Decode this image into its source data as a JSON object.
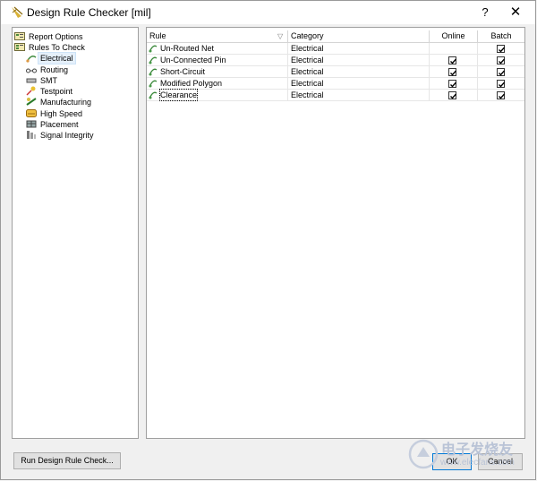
{
  "window": {
    "title": "Design Rule Checker [mil]",
    "help_glyph": "?",
    "close_glyph": "✕"
  },
  "tree": {
    "items": [
      {
        "label": "Report Options",
        "icon": "report-options-icon"
      },
      {
        "label": "Rules To Check",
        "icon": "rules-to-check-icon"
      },
      {
        "label": "Electrical",
        "icon": "electrical-icon",
        "selected": true
      },
      {
        "label": "Routing",
        "icon": "routing-icon"
      },
      {
        "label": "SMT",
        "icon": "smt-icon"
      },
      {
        "label": "Testpoint",
        "icon": "testpoint-icon"
      },
      {
        "label": "Manufacturing",
        "icon": "manufacturing-icon"
      },
      {
        "label": "High Speed",
        "icon": "high-speed-icon"
      },
      {
        "label": "Placement",
        "icon": "placement-icon"
      },
      {
        "label": "Signal Integrity",
        "icon": "signal-integrity-icon"
      }
    ]
  },
  "grid": {
    "columns": {
      "rule": "Rule",
      "category": "Category",
      "online": "Online",
      "batch": "Batch"
    },
    "rows": [
      {
        "rule": "Un-Routed Net",
        "category": "Electrical",
        "online": false,
        "batch": true
      },
      {
        "rule": "Un-Connected Pin",
        "category": "Electrical",
        "online": true,
        "batch": true
      },
      {
        "rule": "Short-Circuit",
        "category": "Electrical",
        "online": true,
        "batch": true
      },
      {
        "rule": "Modified Polygon",
        "category": "Electrical",
        "online": true,
        "batch": true
      },
      {
        "rule": "Clearance",
        "category": "Electrical",
        "online": true,
        "batch": true
      }
    ]
  },
  "buttons": {
    "run": "Run Design Rule Check...",
    "ok": "OK",
    "cancel": "Cancel"
  },
  "watermark": {
    "text": "电子发烧友",
    "url": "www.elecfans.com"
  }
}
